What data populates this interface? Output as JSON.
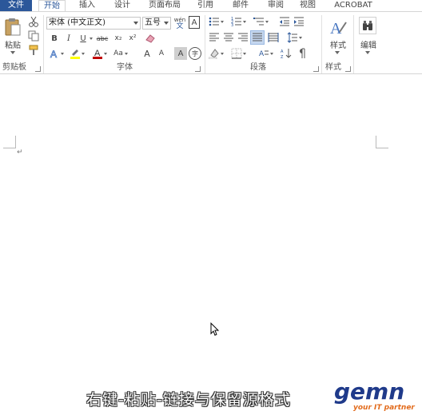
{
  "tabs": [
    {
      "label": "文件"
    },
    {
      "label": "开始"
    },
    {
      "label": "插入"
    },
    {
      "label": "设计"
    },
    {
      "label": "页面布局"
    },
    {
      "label": "引用"
    },
    {
      "label": "邮件"
    },
    {
      "label": "审阅"
    },
    {
      "label": "视图"
    },
    {
      "label": "ACROBAT"
    }
  ],
  "ribbon": {
    "clipboard": {
      "paste_label": "粘贴",
      "group_label": "剪贴板"
    },
    "font": {
      "font_name": "宋体 (中文正文)",
      "font_size": "五号",
      "phonetic_label": "wén",
      "group_label": "字体",
      "bold": "B",
      "italic": "I",
      "underline": "U",
      "strike": "abc",
      "subscript": "x₂",
      "superscript": "x²",
      "change_case": "Aa",
      "grow": "A",
      "shrink": "A",
      "char_shade": "A",
      "enclose": "字"
    },
    "paragraph": {
      "group_label": "段落"
    },
    "styles": {
      "styles_label": "样式",
      "group_label": "样式"
    },
    "editing": {
      "edit_label": "编辑"
    }
  },
  "document": {
    "paragraph_mark": "↵"
  },
  "caption": "右键-粘贴-链接与保留源格式",
  "logo": {
    "word": "gemn",
    "tagline": "your IT partner"
  },
  "colors": {
    "accent": "#2b579a",
    "highlight": "#ffff00",
    "font_color": "#c00000",
    "logo_blue": "#1f3a8a",
    "logo_orange": "#e26b1c"
  }
}
